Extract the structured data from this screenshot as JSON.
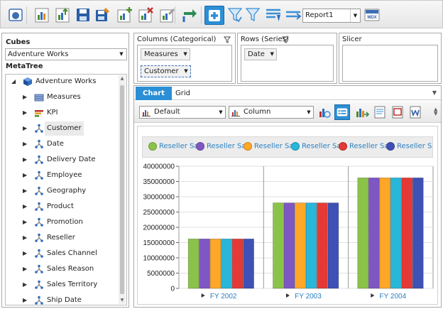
{
  "toolbar": {
    "report_select": "Report1",
    "buttons": [
      {
        "name": "connect-icon",
        "color": "#3b6fb5"
      },
      {
        "name": "report-icon",
        "color": "#4a8e2f"
      },
      {
        "name": "report-up-icon",
        "color": "#4a8e2f"
      },
      {
        "name": "save-icon",
        "color": "#2a5ea6"
      },
      {
        "name": "save-as-icon",
        "color": "#2a5ea6"
      },
      {
        "name": "add-report-icon",
        "color": "#4a8e2f"
      },
      {
        "name": "delete-report-icon",
        "color": "#c0312a"
      },
      {
        "name": "rename-report-icon",
        "color": "#4a8e2f"
      },
      {
        "name": "swap-axes-icon",
        "color": "#2e8b57"
      },
      {
        "name": "add-calculation-icon",
        "color": "#2b8fd6"
      },
      {
        "name": "filter-icon",
        "color": "#3a8fd6"
      },
      {
        "name": "filter-clear-icon",
        "color": "#3a8fd6"
      },
      {
        "name": "sort-icon",
        "color": "#3a8fd6"
      },
      {
        "name": "switch-icon",
        "color": "#3a8fd6"
      },
      {
        "name": "mdx-icon",
        "color": "#3b6fb5"
      }
    ],
    "mdx_label": "MDX"
  },
  "left": {
    "cubes_label": "Cubes",
    "cube_selected": "Adventure Works",
    "metatree_label": "MetaTree",
    "root": "Adventure Works",
    "items": [
      {
        "label": "Measures",
        "icon": "measures-icon"
      },
      {
        "label": "KPI",
        "icon": "kpi-icon"
      },
      {
        "label": "Customer",
        "icon": "dimension-icon",
        "selected": true
      },
      {
        "label": "Date",
        "icon": "dimension-icon"
      },
      {
        "label": "Delivery Date",
        "icon": "dimension-icon"
      },
      {
        "label": "Employee",
        "icon": "dimension-icon"
      },
      {
        "label": "Geography",
        "icon": "dimension-icon"
      },
      {
        "label": "Product",
        "icon": "dimension-icon"
      },
      {
        "label": "Promotion",
        "icon": "dimension-icon"
      },
      {
        "label": "Reseller",
        "icon": "dimension-icon"
      },
      {
        "label": "Sales Channel",
        "icon": "dimension-icon"
      },
      {
        "label": "Sales Reason",
        "icon": "dimension-icon"
      },
      {
        "label": "Sales Territory",
        "icon": "dimension-icon"
      },
      {
        "label": "Ship Date",
        "icon": "dimension-icon"
      }
    ]
  },
  "columns": {
    "title": "Columns (Categorical)",
    "chips": [
      "Measures",
      "Customer"
    ]
  },
  "rows": {
    "title": "Rows (Series)",
    "chips": [
      "Date"
    ]
  },
  "slicer": {
    "title": "Slicer"
  },
  "tabs": {
    "chart": "Chart",
    "grid": "Grid"
  },
  "chart_toolbar": {
    "style": "Default",
    "type": "Column"
  },
  "chart_data": {
    "type": "bar",
    "categories": [
      "FY 2002",
      "FY 2003",
      "FY 2004"
    ],
    "series": [
      {
        "name": "Reseller Sa",
        "color": "#8bc34a",
        "values": [
          16200000,
          28000000,
          36200000
        ]
      },
      {
        "name": "Reseller Sa",
        "color": "#7e57c2",
        "values": [
          16200000,
          28000000,
          36200000
        ]
      },
      {
        "name": "Reseller Sa",
        "color": "#ffa726",
        "values": [
          16200000,
          28000000,
          36200000
        ]
      },
      {
        "name": "Reseller Sa",
        "color": "#29b6d8",
        "values": [
          16200000,
          28000000,
          36200000
        ]
      },
      {
        "name": "Reseller Sa",
        "color": "#e53935",
        "values": [
          16200000,
          28000000,
          36200000
        ]
      },
      {
        "name": "Reseller Sa",
        "color": "#3f51b5",
        "values": [
          16200000,
          28000000,
          36200000
        ]
      }
    ],
    "yticks": [
      "40000000",
      "35000000",
      "30000000",
      "25000000",
      "20000000",
      "15000000",
      "10000000",
      "5000000",
      "0"
    ],
    "ylim": [
      0,
      40000000
    ],
    "legend": "top",
    "grid": true
  }
}
